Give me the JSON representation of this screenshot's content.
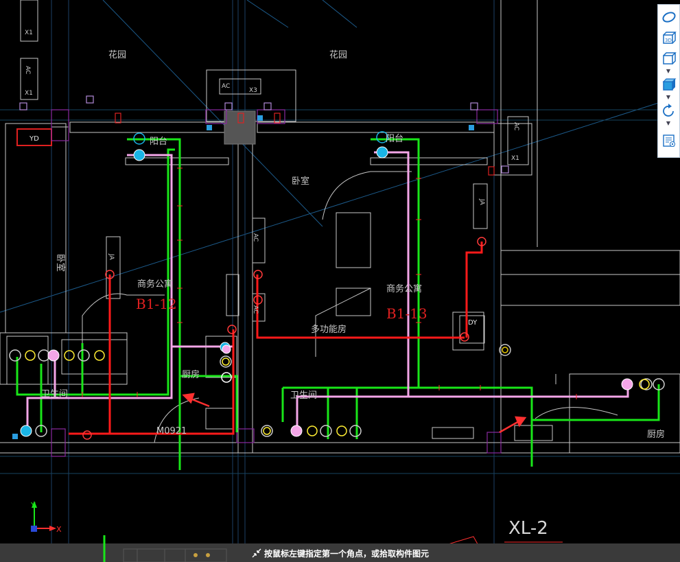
{
  "labels": {
    "garden_left": "花园",
    "garden_right": "花园",
    "balcony_left": "阳台",
    "balcony_right": "阳台",
    "bedroom": "卧室",
    "office_apt_left": "商务公寓",
    "office_apt_right": "商务公寓",
    "unit_left": "B1-12",
    "unit_right": "B1-13",
    "multi_room": "多功能房",
    "kitchen_left": "厨房",
    "kitchen_right": "厨房",
    "bathroom_left": "卫生间",
    "bathroom_right": "卫生间",
    "bedroom_side": "卧室",
    "door_code": "M0921",
    "riser": "XL-2",
    "ac_x3_ac": "AC",
    "ac_x3_x": "X3",
    "ac_left_top": "AC",
    "x1_left_a": "X1",
    "x1_left_b": "X1",
    "x1_right": "X1",
    "ac_right": "AC",
    "yd": "YD",
    "dy": "DY",
    "ja_left": "JA",
    "ja_mid": "AC",
    "ja_mid2": "AC",
    "ja_right": "JA",
    "axis_x": "X",
    "axis_y": "Y"
  },
  "toolbar": {
    "items": [
      "orbit-icon",
      "view-3d-icon",
      "view-box-icon",
      "view-cube-icon",
      "rotate-icon",
      "properties-list-icon"
    ],
    "text_3d": "3D"
  },
  "status": {
    "message": "按鼠标左键指定第一个角点，或拾取构件图元"
  },
  "colors": {
    "green_pipe": "#19e619",
    "red_pipe": "#ff1a1a",
    "pink_pipe": "#f4a6e8",
    "wall": "#d8d8d8",
    "guide_blue": "#2a6aa0",
    "purple": "#8a2aa0",
    "background": "#000000",
    "arrow": "#ff3030"
  }
}
